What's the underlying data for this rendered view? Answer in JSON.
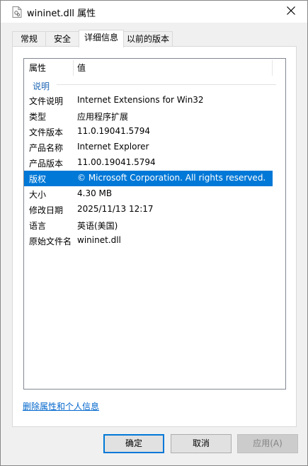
{
  "window": {
    "title": "wininet.dll 属性",
    "icon": "file-icon",
    "close_icon": "close-icon"
  },
  "tabs": [
    {
      "label": "常规"
    },
    {
      "label": "安全"
    },
    {
      "label": "详细信息",
      "active": true
    },
    {
      "label": "以前的版本"
    }
  ],
  "details": {
    "columns": {
      "property": "属性",
      "value": "值"
    },
    "group": "说明",
    "rows": [
      {
        "key": "文件说明",
        "value": "Internet Extensions for Win32"
      },
      {
        "key": "类型",
        "value": "应用程序扩展"
      },
      {
        "key": "文件版本",
        "value": "11.0.19041.5794"
      },
      {
        "key": "产品名称",
        "value": "Internet Explorer"
      },
      {
        "key": "产品版本",
        "value": "11.00.19041.5794"
      },
      {
        "key": "版权",
        "value": "© Microsoft Corporation. All rights reserved.",
        "selected": true
      },
      {
        "key": "大小",
        "value": "4.30 MB"
      },
      {
        "key": "修改日期",
        "value": "2025/11/13 12:17"
      },
      {
        "key": "语言",
        "value": "英语(美国)"
      },
      {
        "key": "原始文件名",
        "value": "wininet.dll"
      }
    ]
  },
  "remove_link": "删除属性和个人信息",
  "buttons": {
    "ok": "确定",
    "cancel": "取消",
    "apply": "应用(A)"
  },
  "colors": {
    "selection": "#0078d7",
    "link": "#0066cc",
    "group": "#1e66b4"
  }
}
